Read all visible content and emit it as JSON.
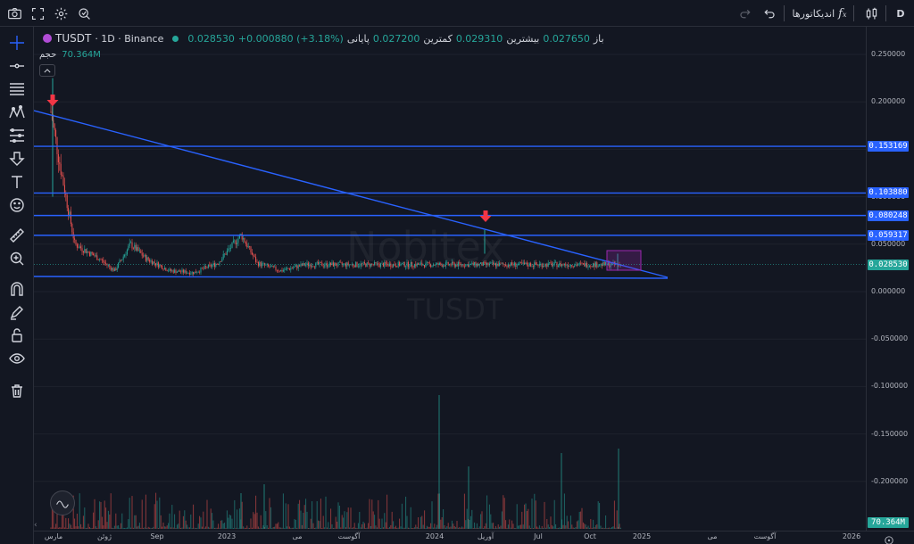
{
  "toolbar": {
    "interval": "D",
    "indicators_label": "اندیکاتورها"
  },
  "legend": {
    "symbol": "TUSDT",
    "interval_exchange": "· 1D · Binance",
    "open_label": "باز",
    "open_value": "0.027650",
    "high_label": "بیشترین",
    "high_value": "0.029310",
    "low_label": "کمترین",
    "low_value": "0.027200",
    "close_label": "پایانی",
    "close_value": "0.028530",
    "change_value": "+0.000880 (+3.18%)",
    "volume_label": "حجم",
    "volume_value": "70.364M"
  },
  "watermark": {
    "brand": "Nobitex",
    "symbol": "TUSDT"
  },
  "price_axis": {
    "ticks": [
      "0.250000",
      "0.200000",
      "0.150000",
      "0.100000",
      "0.050000",
      "0.000000",
      "-0.050000",
      "-0.100000",
      "-0.150000",
      "-0.200000"
    ],
    "tags": [
      {
        "label": "0.153169",
        "color": "#2962ff"
      },
      {
        "label": "0.103880",
        "color": "#2962ff"
      },
      {
        "label": "0.080248",
        "color": "#2962ff"
      },
      {
        "label": "0.059317",
        "color": "#2962ff"
      },
      {
        "label": "0.028530",
        "color": "#26a69a"
      },
      {
        "label": "70.364M",
        "color": "#26a69a"
      }
    ]
  },
  "time_axis": {
    "labels": [
      "مارس",
      "ژوئن",
      "Sep",
      "2023",
      "می",
      "آگوست",
      "2024",
      "آوریل",
      "Jul",
      "Oct",
      "2025",
      "می",
      "آگوست",
      "2026"
    ]
  },
  "colors": {
    "background": "#131722",
    "up": "#26a69a",
    "down": "#ef5350",
    "drawing": "#2962ff",
    "rect_border": "#9c27b0",
    "arrow": "#f23645"
  },
  "chart_data": {
    "type": "candlestick",
    "symbol": "TUSDT",
    "interval": "1D",
    "exchange": "Binance",
    "ylim": [
      -0.25,
      0.27
    ],
    "horizontal_levels": [
      0.153169,
      0.10388,
      0.080248,
      0.059317
    ],
    "last_price": 0.02853,
    "approx_series": [
      {
        "x": "2022-03",
        "y": 0.19
      },
      {
        "x": "2022-04",
        "y": 0.14
      },
      {
        "x": "2022-05",
        "y": 0.095
      },
      {
        "x": "2022-06",
        "y": 0.05
      },
      {
        "x": "2022-07",
        "y": 0.045
      },
      {
        "x": "2022-09",
        "y": 0.035
      },
      {
        "x": "2022-11",
        "y": 0.022
      },
      {
        "x": "2023-01",
        "y": 0.05
      },
      {
        "x": "2023-03",
        "y": 0.035
      },
      {
        "x": "2023-06",
        "y": 0.022
      },
      {
        "x": "2023-09",
        "y": 0.02
      },
      {
        "x": "2023-12",
        "y": 0.03
      },
      {
        "x": "2024-03",
        "y": 0.06
      },
      {
        "x": "2024-05",
        "y": 0.03
      },
      {
        "x": "2024-08",
        "y": 0.022
      },
      {
        "x": "2024-11",
        "y": 0.0285
      }
    ]
  }
}
